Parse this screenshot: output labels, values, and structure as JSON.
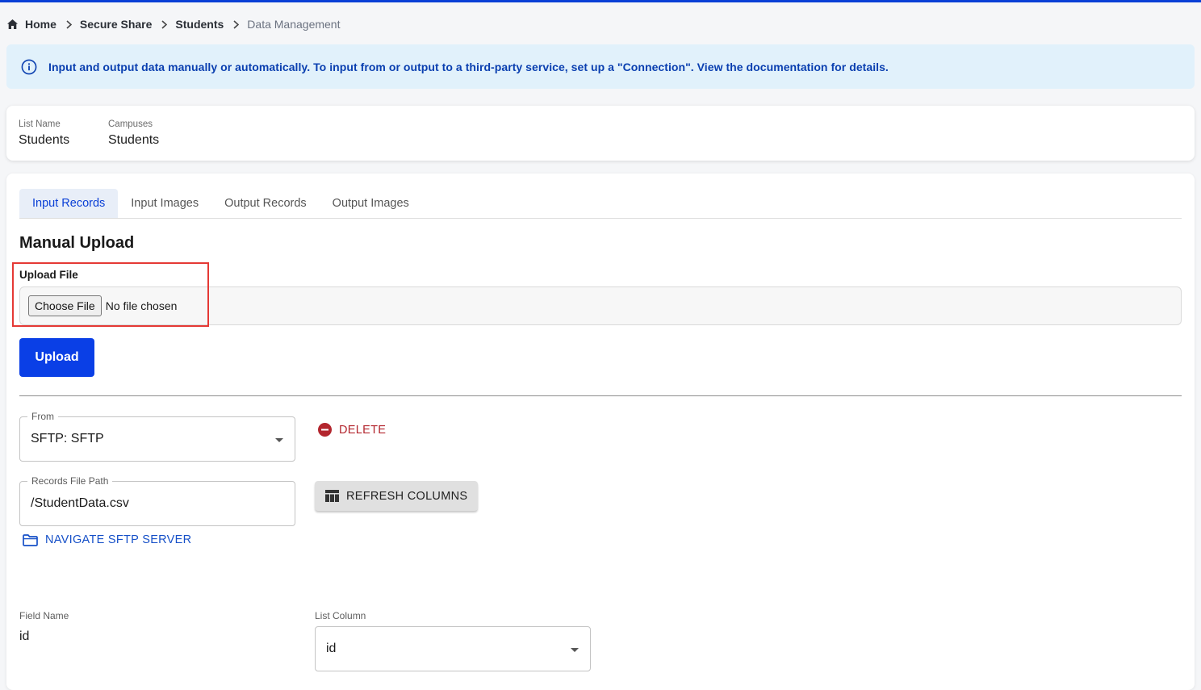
{
  "breadcrumb": {
    "items": [
      "Home",
      "Secure Share",
      "Students",
      "Data Management"
    ]
  },
  "banner": {
    "text": "Input and output data manually or automatically. To input from or output to a third-party service, set up a \"Connection\". View the documentation for details."
  },
  "list_info": {
    "list_name_label": "List Name",
    "list_name_value": "Students",
    "campuses_label": "Campuses",
    "campuses_value": "Students"
  },
  "tabs": [
    {
      "label": "Input Records",
      "active": true
    },
    {
      "label": "Input Images",
      "active": false
    },
    {
      "label": "Output Records",
      "active": false
    },
    {
      "label": "Output Images",
      "active": false
    }
  ],
  "manual_upload": {
    "title": "Manual Upload",
    "upload_file_label": "Upload File",
    "choose_file_label": "Choose File",
    "file_status": "No file chosen",
    "upload_button": "Upload"
  },
  "connection": {
    "from_label": "From",
    "from_value": "SFTP: SFTP",
    "delete_label": "DELETE",
    "records_path_label": "Records File Path",
    "records_path_value": "/StudentData.csv",
    "refresh_label": "REFRESH COLUMNS",
    "navigate_label": "NAVIGATE SFTP SERVER"
  },
  "mapping": {
    "field_name_header": "Field Name",
    "list_column_header": "List Column",
    "rows": [
      {
        "field": "id",
        "column": "id"
      }
    ]
  },
  "colors": {
    "accent": "#0a3fd6",
    "danger": "#b3262e",
    "banner_bg": "#e1f1fb",
    "highlight": "#e53935"
  }
}
